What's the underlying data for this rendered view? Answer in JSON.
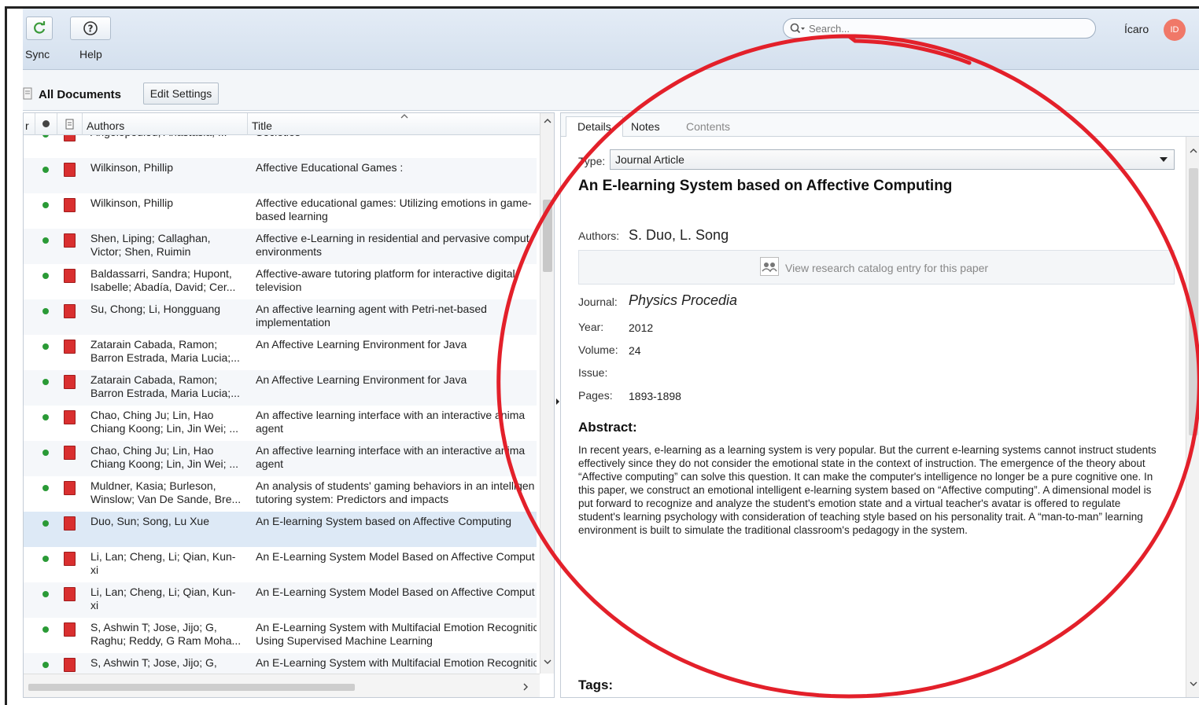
{
  "toolbar": {
    "sync_label": "Sync",
    "help_label": "Help",
    "search_placeholder": "Search...",
    "user_name": "Ícaro",
    "avatar_initials": "ID"
  },
  "docs_bar": {
    "title": "All Documents",
    "edit_settings_label": "Edit Settings"
  },
  "list": {
    "columns": {
      "authors": "Authors",
      "title": "Title"
    },
    "rows": [
      {
        "authors": "Angelopoulou, Anastasia; ...",
        "title": "Societies"
      },
      {
        "authors": "Wilkinson, Phillip",
        "title": "Affective Educational Games :"
      },
      {
        "authors": "Wilkinson, Phillip",
        "title": "Affective educational games: Utilizing emotions in game-\nbased learning"
      },
      {
        "authors": "Shen, Liping; Callaghan,\nVictor; Shen, Ruimin",
        "title": "Affective e-Learning in residential and pervasive comput\nenvironments"
      },
      {
        "authors": "Baldassarri, Sandra; Hupont,\nIsabelle; Abadía, David; Cer...",
        "title": "Affective-aware tutoring platform for interactive digital\ntelevision"
      },
      {
        "authors": "Su, Chong; Li, Hongguang",
        "title": "An affective learning agent with Petri-net-based\nimplementation"
      },
      {
        "authors": "Zatarain Cabada, Ramon;\nBarron Estrada, Maria Lucia;...",
        "title": "An Affective Learning Environment for Java"
      },
      {
        "authors": "Zatarain Cabada, Ramon;\nBarron Estrada, Maria Lucia;...",
        "title": "An Affective Learning Environment for Java"
      },
      {
        "authors": "Chao, Ching Ju; Lin, Hao\nChiang Koong; Lin, Jin Wei; ...",
        "title": "An affective learning interface with an interactive anima\nagent"
      },
      {
        "authors": "Chao, Ching Ju; Lin, Hao\nChiang Koong; Lin, Jin Wei; ...",
        "title": "An affective learning interface with an interactive anima\nagent"
      },
      {
        "authors": "Muldner, Kasia; Burleson,\nWinslow; Van De Sande, Bre...",
        "title": "An analysis of students' gaming behaviors in an intelligen\ntutoring system: Predictors and impacts"
      },
      {
        "authors": "Duo, Sun; Song, Lu Xue",
        "title": "An E-learning System based on Affective Computing"
      },
      {
        "authors": "Li, Lan; Cheng, Li; Qian, Kun-\nxi",
        "title": "An E-Learning System Model Based on Affective Comput"
      },
      {
        "authors": "Li, Lan; Cheng, Li; Qian, Kun-\nxi",
        "title": "An E-Learning System Model Based on Affective Comput"
      },
      {
        "authors": "S, Ashwin T; Jose, Jijo; G,\nRaghu; Reddy, G Ram Moha...",
        "title": "An E-Learning System with Multifacial Emotion Recognitic\nUsing Supervised Machine Learning"
      },
      {
        "authors": "S, Ashwin T; Jose, Jijo; G,",
        "title": "An E-Learning System with Multifacial Emotion Recognitic"
      }
    ]
  },
  "details": {
    "tabs": [
      "Details",
      "Notes",
      "Contents"
    ],
    "type_label": "Type:",
    "type_value": "Journal Article",
    "paper_title": "An E-learning System based on Affective Computing",
    "authors_label": "Authors:",
    "authors_value": "S. Duo, L. Song",
    "catalog_text": "View research catalog entry for this paper",
    "journal_label": "Journal:",
    "journal_value": "Physics Procedia",
    "year_label": "Year:",
    "year_value": "2012",
    "volume_label": "Volume:",
    "volume_value": "24",
    "issue_label": "Issue:",
    "issue_value": "",
    "pages_label": "Pages:",
    "pages_value": "1893-1898",
    "abstract_heading": "Abstract:",
    "abstract_text": "In recent years, e-learning as a learning system is very popular. But the current e-learning systems cannot instruct students effectively since they do not consider the emotional state in the context of instruction. The emergence of the theory about “Affective computing” can solve this question. It can make the computer's intelligence no longer be a pure cognitive one. In this paper, we construct an emotional intelligent e-learning system based on “Affective computing”. A dimensional model is put forward to recognize and analyze the student's emotion state and a virtual teacher's avatar is offered to regulate student's learning psychology with consideration of teaching style based on his personality trait. A “man-to-man” learning environment is built to simulate the traditional classroom's pedagogy in the system.",
    "tags_heading": "Tags:"
  },
  "colors": {
    "annotation_ring": "#e3202a",
    "selected_row": "#dde9f6",
    "read_dot": "#2a9a36",
    "pdf_icon": "#d92f2f"
  }
}
